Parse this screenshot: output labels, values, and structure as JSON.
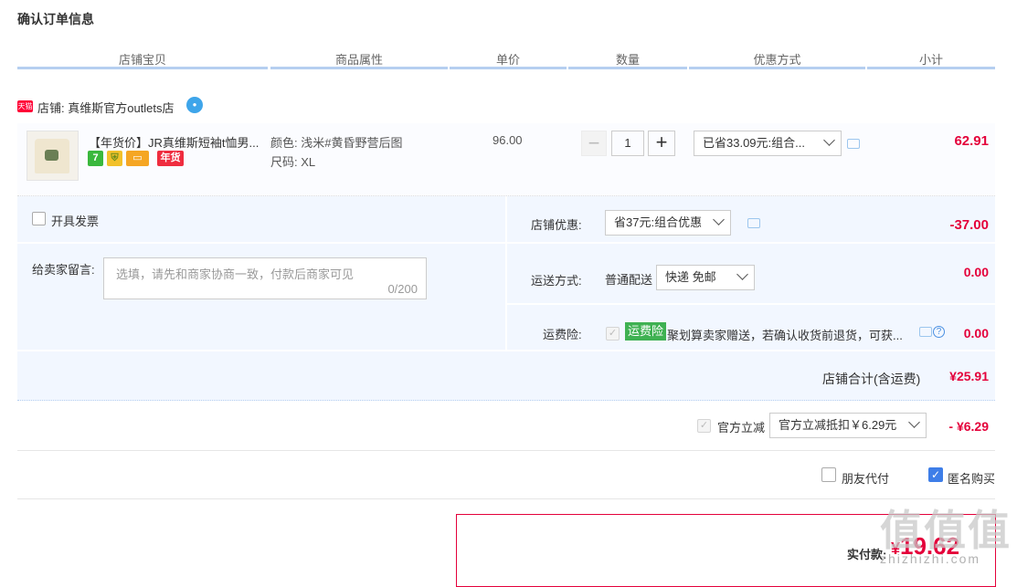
{
  "page_title": "确认订单信息",
  "columns": [
    "店铺宝贝",
    "商品属性",
    "单价",
    "数量",
    "优惠方式",
    "小计"
  ],
  "shop": {
    "logo_text": "天猫",
    "name": "店铺: 真维斯官方outlets店"
  },
  "item": {
    "title": "【年货价】JR真维斯短袖t恤男...",
    "badge_nianhuo": "年货",
    "badge_seven": "7",
    "attr_color": "颜色: 浅米#黄昏野营后图",
    "attr_size": "尺码: XL",
    "unit_price": "96.00",
    "qty_minus": "−",
    "quantity": "1",
    "qty_plus": "+",
    "discount_select": "已省33.09元:组合...",
    "subtotal": "62.91"
  },
  "invoice": {
    "label": "开具发票"
  },
  "message": {
    "label": "给卖家留言:",
    "placeholder": "选填，请先和商家协商一致，付款后商家可见",
    "counter": "0/200"
  },
  "shop_discount": {
    "label": "店铺优惠:",
    "select": "省37元:组合优惠",
    "amount": "-37.00"
  },
  "shipping": {
    "label": "运送方式:",
    "method": "普通配送",
    "select": "快递 免邮",
    "amount": "0.00"
  },
  "freight_insurance": {
    "label": "运费险:",
    "badge": "运费险",
    "text": "聚划算卖家赠送，若确认收货前退货，可获...",
    "amount": "0.00",
    "help": "?"
  },
  "shop_total": {
    "label": "店铺合计(含运费)",
    "amount": "¥25.91"
  },
  "official": {
    "label": "官方立减",
    "select": "官方立减抵扣￥6.29元",
    "amount": "- ¥6.29"
  },
  "friend_pay": {
    "label": "朋友代付"
  },
  "anonymous": {
    "label": "匿名购买"
  },
  "payment": {
    "label": "实付款:",
    "currency": "¥",
    "amount": "19.62"
  },
  "watermark": {
    "main": "值值值",
    "sub": "zhizhizhi.com"
  },
  "colors": {
    "accent_red": "#e4003a",
    "header_line": "#b6cff0",
    "option_bg": "#f2f7ff",
    "checkbox_blue": "#3e7ee8",
    "badge_green": "#3fb152"
  }
}
